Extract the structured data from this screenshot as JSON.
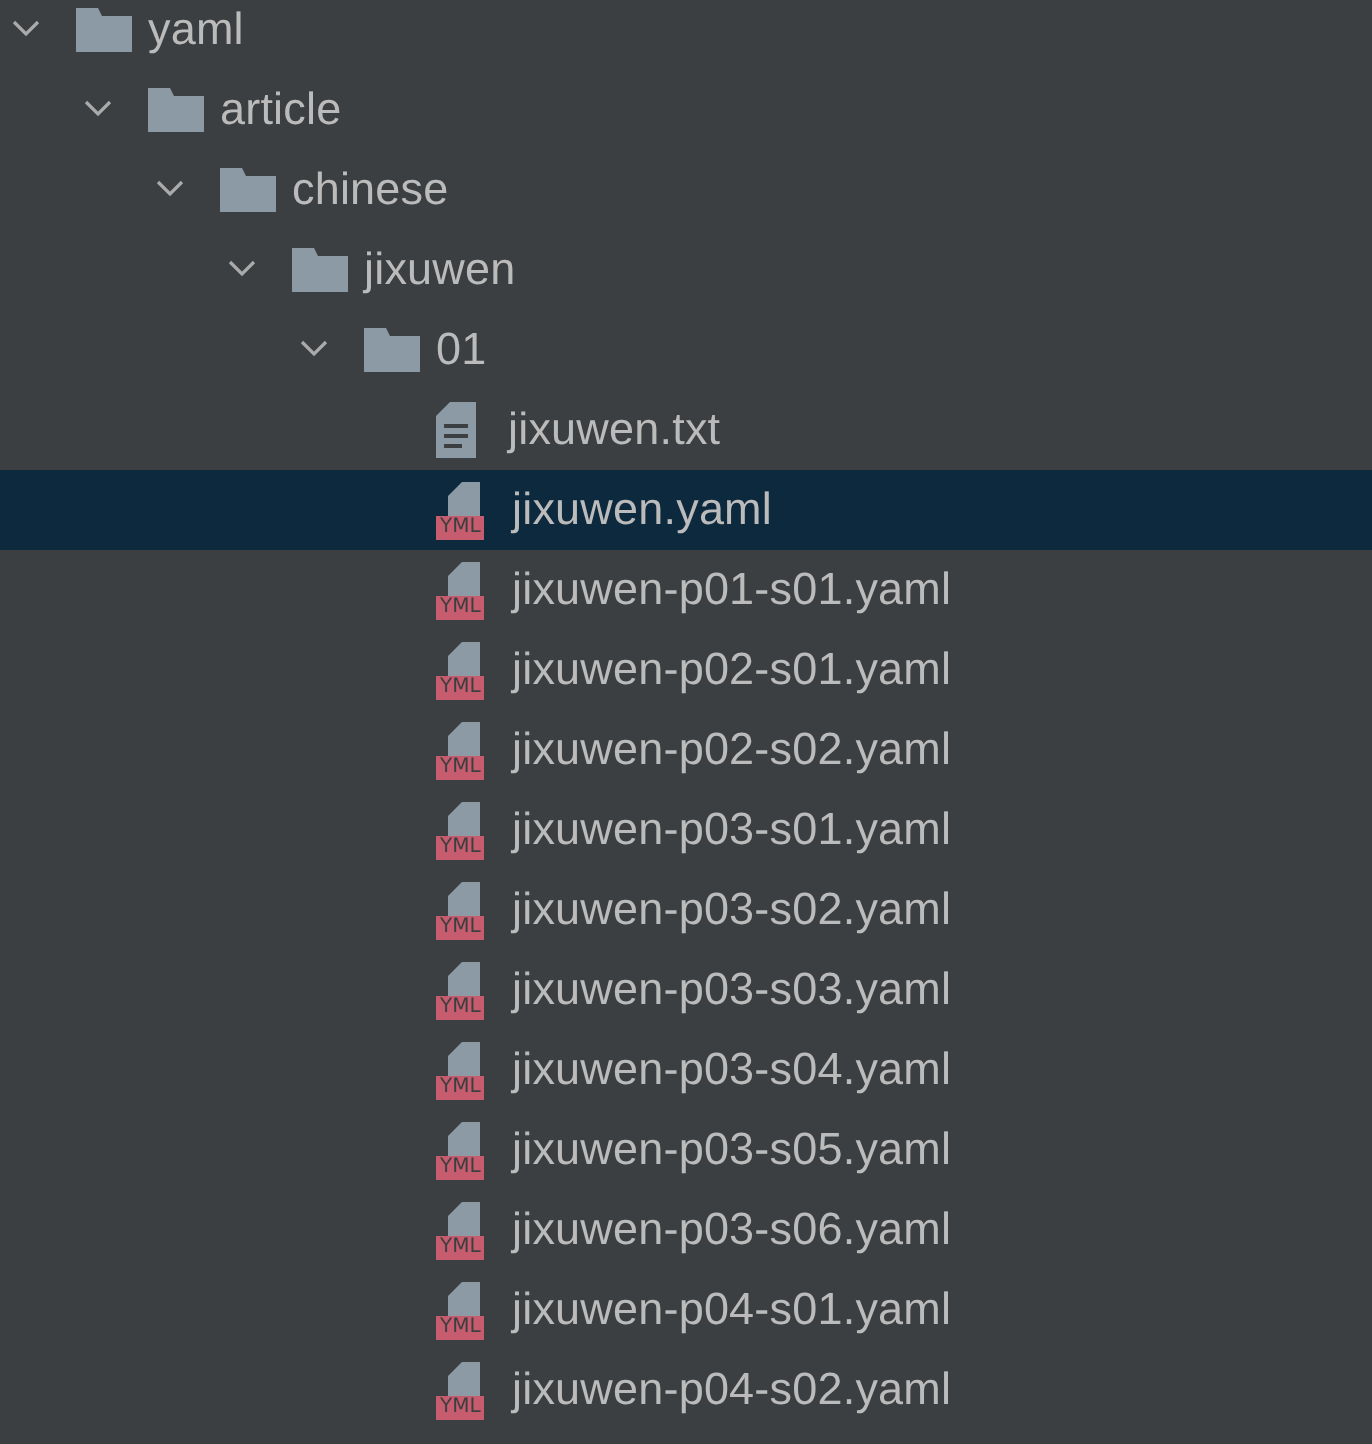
{
  "tree": [
    {
      "kind": "folder",
      "label": "yaml",
      "expanded": true,
      "selected": false,
      "children": [
        {
          "kind": "folder",
          "label": "article",
          "expanded": true,
          "selected": false,
          "children": [
            {
              "kind": "folder",
              "label": "chinese",
              "expanded": true,
              "selected": false,
              "children": [
                {
                  "kind": "folder",
                  "label": "jixuwen",
                  "expanded": true,
                  "selected": false,
                  "children": [
                    {
                      "kind": "folder",
                      "label": "01",
                      "expanded": true,
                      "selected": false,
                      "children": [
                        {
                          "kind": "text",
                          "label": "jixuwen.txt",
                          "selected": false
                        },
                        {
                          "kind": "yaml",
                          "label": "jixuwen.yaml",
                          "badge": "YML",
                          "selected": true
                        },
                        {
                          "kind": "yaml",
                          "label": "jixuwen-p01-s01.yaml",
                          "badge": "YML",
                          "selected": false
                        },
                        {
                          "kind": "yaml",
                          "label": "jixuwen-p02-s01.yaml",
                          "badge": "YML",
                          "selected": false
                        },
                        {
                          "kind": "yaml",
                          "label": "jixuwen-p02-s02.yaml",
                          "badge": "YML",
                          "selected": false
                        },
                        {
                          "kind": "yaml",
                          "label": "jixuwen-p03-s01.yaml",
                          "badge": "YML",
                          "selected": false
                        },
                        {
                          "kind": "yaml",
                          "label": "jixuwen-p03-s02.yaml",
                          "badge": "YML",
                          "selected": false
                        },
                        {
                          "kind": "yaml",
                          "label": "jixuwen-p03-s03.yaml",
                          "badge": "YML",
                          "selected": false
                        },
                        {
                          "kind": "yaml",
                          "label": "jixuwen-p03-s04.yaml",
                          "badge": "YML",
                          "selected": false
                        },
                        {
                          "kind": "yaml",
                          "label": "jixuwen-p03-s05.yaml",
                          "badge": "YML",
                          "selected": false
                        },
                        {
                          "kind": "yaml",
                          "label": "jixuwen-p03-s06.yaml",
                          "badge": "YML",
                          "selected": false
                        },
                        {
                          "kind": "yaml",
                          "label": "jixuwen-p04-s01.yaml",
                          "badge": "YML",
                          "selected": false
                        },
                        {
                          "kind": "yaml",
                          "label": "jixuwen-p04-s02.yaml",
                          "badge": "YML",
                          "selected": false
                        }
                      ]
                    }
                  ]
                }
              ]
            }
          ]
        }
      ]
    }
  ]
}
